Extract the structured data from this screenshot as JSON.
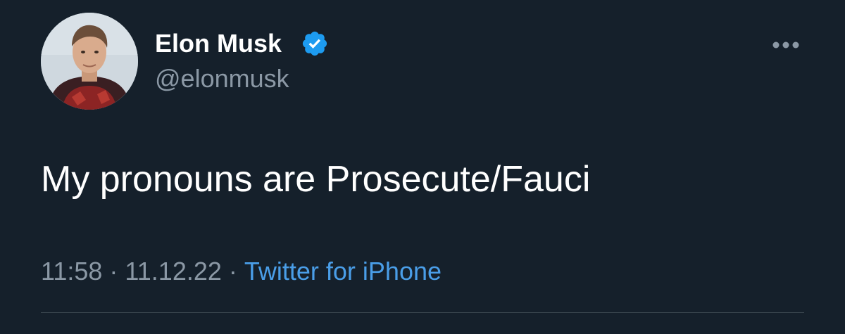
{
  "tweet": {
    "author": {
      "display_name": "Elon Musk",
      "handle": "@elonmusk",
      "verified": true
    },
    "text": "My pronouns are Prosecute/Fauci",
    "time": "11:58",
    "date": "11.12.22",
    "source": "Twitter for iPhone",
    "separator": "·"
  },
  "colors": {
    "background": "#15202b",
    "text_primary": "#ffffff",
    "text_secondary": "#8b98a5",
    "accent": "#4a9ee8",
    "verified_badge": "#1d9bf0",
    "divider": "#38444d"
  },
  "icons": {
    "verified": "verified-badge-icon",
    "more": "more-options-icon"
  }
}
